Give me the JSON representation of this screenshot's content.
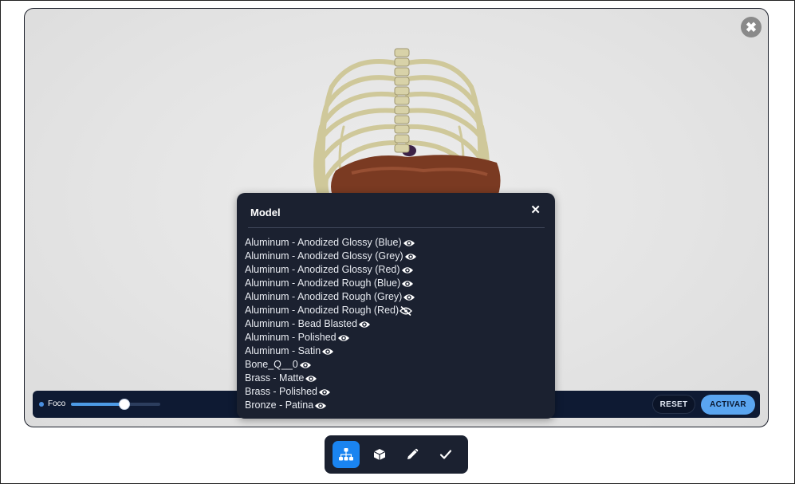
{
  "viewer": {
    "close_icon": "close-icon",
    "controls": {
      "focus_label": "Foco",
      "focus_value": 0.6,
      "reset_label": "RESET",
      "activate_label": "ACTIVAR"
    }
  },
  "panel": {
    "title": "Model",
    "close_symbol": "✕",
    "materials": [
      {
        "label": "Aluminum - Anodized Glossy (Blue)",
        "visible": true
      },
      {
        "label": "Aluminum - Anodized Glossy (Grey)",
        "visible": true
      },
      {
        "label": "Aluminum - Anodized Glossy (Red)",
        "visible": true
      },
      {
        "label": "Aluminum - Anodized Rough (Blue)",
        "visible": true
      },
      {
        "label": "Aluminum - Anodized Rough (Grey)",
        "visible": true
      },
      {
        "label": "Aluminum - Anodized Rough (Red)",
        "visible": false
      },
      {
        "label": "Aluminum - Bead Blasted",
        "visible": true
      },
      {
        "label": "Aluminum - Polished",
        "visible": true
      },
      {
        "label": "Aluminum - Satin",
        "visible": true
      },
      {
        "label": "Bone_Q__0",
        "visible": true
      },
      {
        "label": "Brass - Matte",
        "visible": true
      },
      {
        "label": "Brass - Polished",
        "visible": true
      },
      {
        "label": "Bronze - Patina",
        "visible": true
      }
    ]
  },
  "toolbar": {
    "tools": [
      {
        "icon": "hierarchy-icon",
        "active": true
      },
      {
        "icon": "cube-icon",
        "active": false
      },
      {
        "icon": "pencil-icon",
        "active": false
      },
      {
        "icon": "check-icon",
        "active": false
      }
    ]
  },
  "colors": {
    "accent": "#1a84f0",
    "panel_bg": "#1b2130",
    "controls_bg": "#0e1a33",
    "activate_bg": "#5aa5f0"
  }
}
